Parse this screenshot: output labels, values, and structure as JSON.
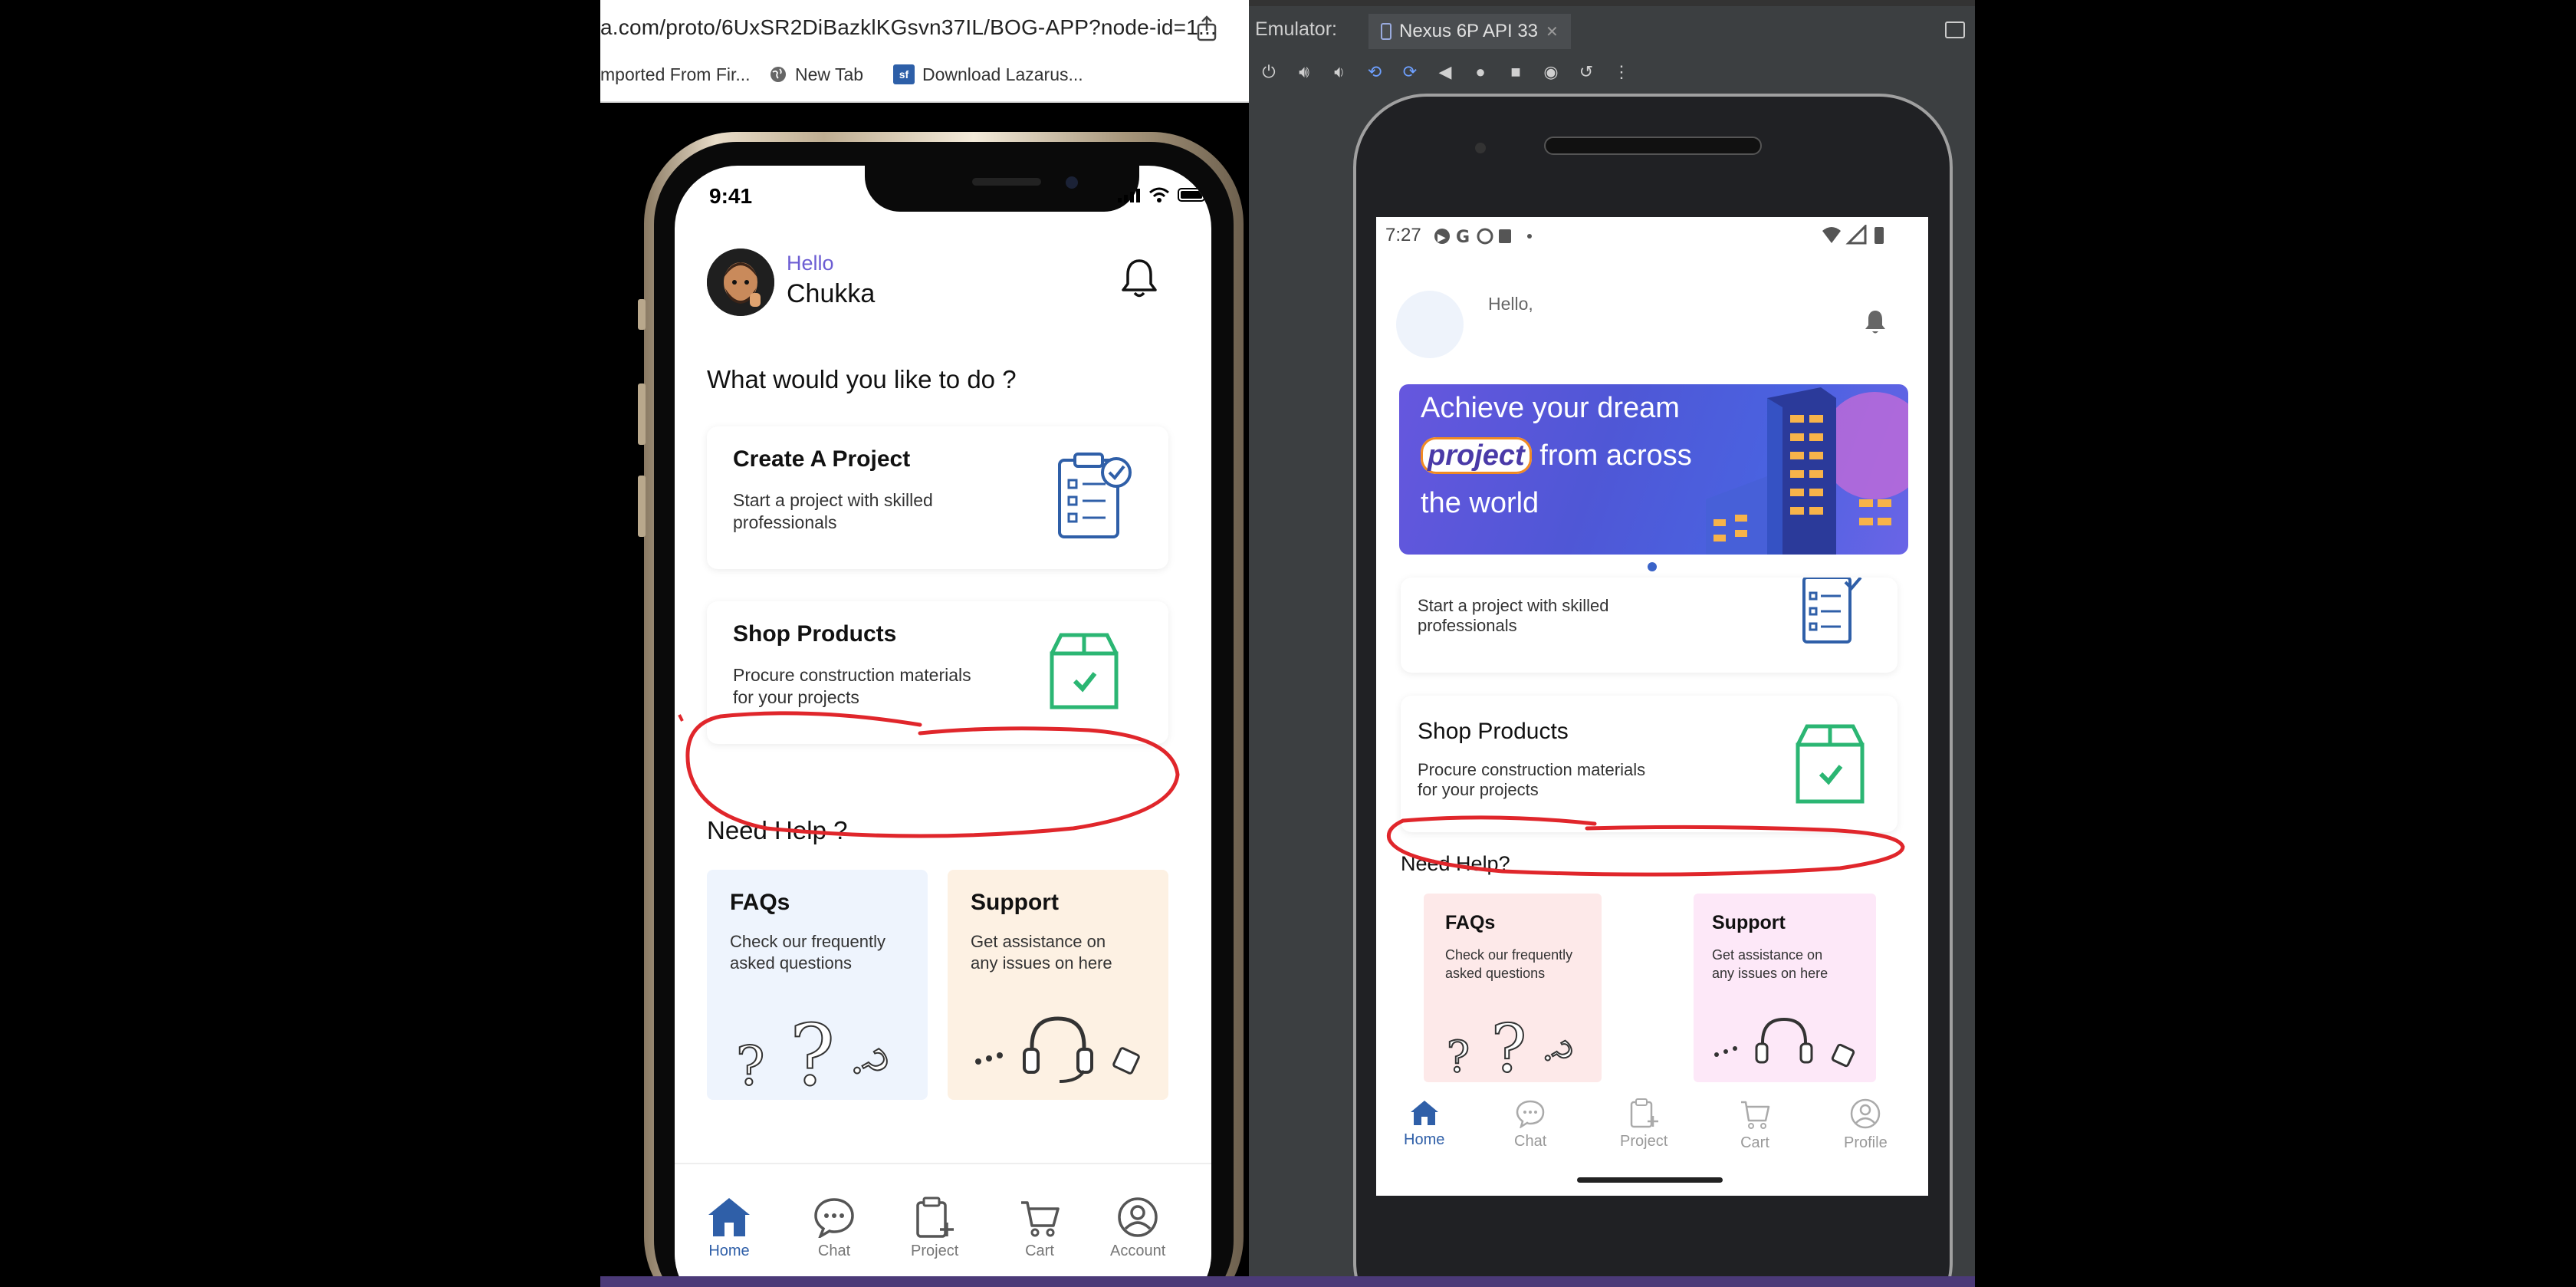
{
  "browser": {
    "url": "a.com/proto/6UxSR2DiBazklKGsvn37IL/BOG-APP?node-id=1...",
    "bookmarks": [
      {
        "label": "mported From Fir...",
        "icon": "folder-icon"
      },
      {
        "label": "New Tab",
        "icon": "globe-icon"
      },
      {
        "label": "Download Lazarus...",
        "icon": "sf-icon"
      }
    ]
  },
  "ios": {
    "time": "9:41",
    "greeting": "Hello",
    "username": "Chukka",
    "question": "What would you like to do ?",
    "cards": [
      {
        "title": "Create A Project",
        "desc_line1": "Start a project with skilled",
        "desc_line2": "professionals"
      },
      {
        "title": "Shop Products",
        "desc_line1": "Procure construction materials",
        "desc_line2": "for your projects"
      }
    ],
    "help_title": "Need Help ?",
    "faq": {
      "title": "FAQs",
      "desc_line1": "Check our frequently",
      "desc_line2": "asked questions"
    },
    "support": {
      "title": "Support",
      "desc_line1": "Get assistance on",
      "desc_line2": "any issues on here"
    },
    "nav": [
      {
        "label": "Home",
        "icon": "home-icon",
        "active": true
      },
      {
        "label": "Chat",
        "icon": "chat-icon",
        "active": false
      },
      {
        "label": "Project",
        "icon": "clipboard-add-icon",
        "active": false
      },
      {
        "label": "Cart",
        "icon": "cart-icon",
        "active": false
      },
      {
        "label": "Account",
        "icon": "account-icon",
        "active": false
      }
    ]
  },
  "emulator": {
    "label": "Emulator:",
    "tab": "Nexus 6P API 33",
    "android": {
      "time": "7:27",
      "greeting": "Hello,",
      "banner": {
        "line1": "Achieve your dream",
        "highlight": "project",
        "line2_rest": "from across",
        "line3": "the world"
      },
      "create_card": {
        "desc_line1": "Start a project with skilled",
        "desc_line2": "professionals"
      },
      "shop_card": {
        "title": "Shop Products",
        "desc_line1": "Procure construction materials",
        "desc_line2": "for your projects"
      },
      "help_title": "Need Help?",
      "faq": {
        "title": "FAQs",
        "desc_line1": "Check our frequently",
        "desc_line2": "asked questions"
      },
      "support": {
        "title": "Support",
        "desc_line1": "Get assistance on",
        "desc_line2": "any issues on here"
      },
      "nav": [
        {
          "label": "Home",
          "icon": "home-icon",
          "active": true
        },
        {
          "label": "Chat",
          "icon": "chat-icon",
          "active": false
        },
        {
          "label": "Project",
          "icon": "clipboard-add-icon",
          "active": false
        },
        {
          "label": "Cart",
          "icon": "cart-icon",
          "active": false
        },
        {
          "label": "Profile",
          "icon": "profile-icon",
          "active": false
        }
      ]
    }
  },
  "colors": {
    "accent_blue": "#2f5fa8",
    "purple_hello": "#6c5dd3",
    "green_box": "#2bb673",
    "annotation_red": "#e0262b",
    "faq_bg": "#eef4fd",
    "support_bg": "#fdf1e3"
  }
}
